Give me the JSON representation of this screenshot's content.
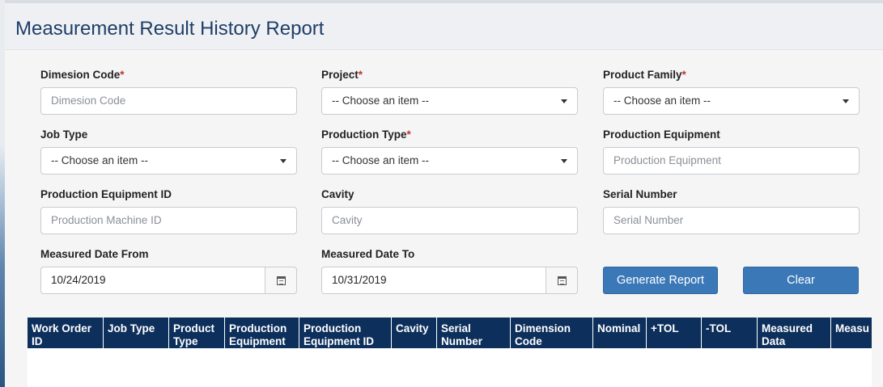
{
  "page": {
    "title": "Measurement Result History Report"
  },
  "form": {
    "dimension_code": {
      "label": "Dimesion Code",
      "required_mark": "*",
      "placeholder": "Dimesion Code"
    },
    "project": {
      "label": "Project",
      "required_mark": "*",
      "value": "-- Choose an item --"
    },
    "product_family": {
      "label": "Product Family",
      "required_mark": "*",
      "value": "-- Choose an item --"
    },
    "job_type": {
      "label": "Job Type",
      "value": "-- Choose an item --"
    },
    "production_type": {
      "label": "Production Type",
      "required_mark": "*",
      "value": "-- Choose an item --"
    },
    "production_equipment": {
      "label": "Production Equipment",
      "placeholder": "Production Equipment"
    },
    "production_equipment_id": {
      "label": "Production Equipment ID",
      "placeholder": "Production Machine ID"
    },
    "cavity": {
      "label": "Cavity",
      "placeholder": "Cavity"
    },
    "serial_number": {
      "label": "Serial Number",
      "placeholder": "Serial Number"
    },
    "measured_date_from": {
      "label": "Measured Date From",
      "value": "10/24/2019"
    },
    "measured_date_to": {
      "label": "Measured Date To",
      "value": "10/31/2019"
    },
    "generate_label": "Generate Report",
    "clear_label": "Clear"
  },
  "table": {
    "columns": [
      "Work Order ID",
      "Job Type",
      "Product Type",
      "Production Equipment",
      "Production Equipment ID",
      "Cavity",
      "Serial Number",
      "Dimension Code",
      "Nominal",
      "+TOL",
      "-TOL",
      "Measured Data",
      "Measu"
    ]
  },
  "colors": {
    "accent": "#3b78b7",
    "table_header": "#0d2f5c",
    "title": "#1f3e66",
    "required": "#c0392b"
  },
  "icons": {
    "calendar": "calendar-icon",
    "dropdown": "chevron-down-icon"
  }
}
